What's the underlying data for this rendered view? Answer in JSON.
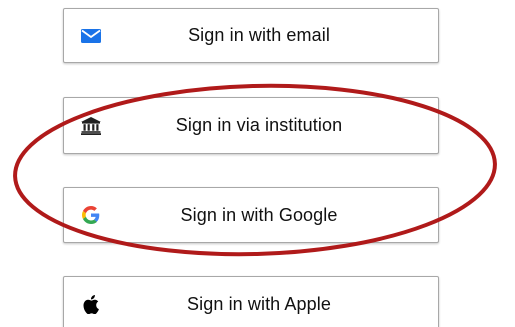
{
  "buttons": {
    "email": {
      "label": "Sign in with email",
      "icon": "envelope-icon",
      "icon_color": "#1a73e8"
    },
    "institution": {
      "label": "Sign in via institution",
      "icon": "institution-building-icon",
      "icon_color": "#222222"
    },
    "google": {
      "label": "Sign in with Google",
      "icon": "google-logo-icon"
    },
    "apple": {
      "label": "Sign in with Apple",
      "icon": "apple-logo-icon",
      "icon_color": "#000000"
    }
  },
  "annotation": {
    "shape": "ellipse",
    "color": "#b01a1a"
  },
  "colors": {
    "button_border": "#a8a8a8",
    "text": "#111111",
    "background": "#ffffff"
  }
}
